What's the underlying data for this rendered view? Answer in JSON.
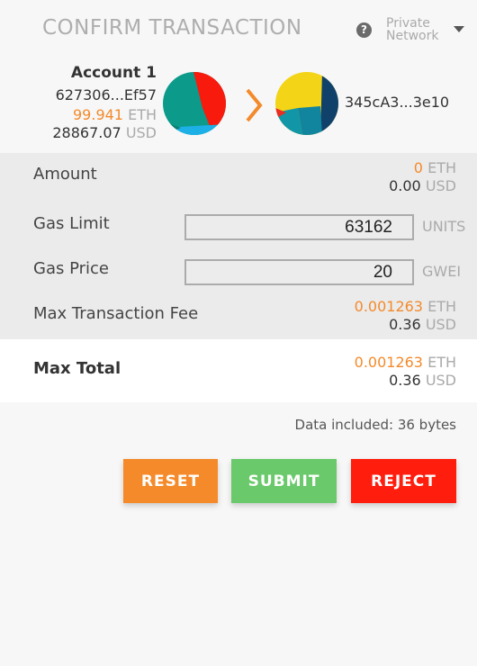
{
  "header": {
    "title": "CONFIRM TRANSACTION",
    "help_icon": "question-circle-icon",
    "network_line1": "Private",
    "network_line2": "Network",
    "network_caret_icon": "caret-down-icon"
  },
  "from": {
    "name": "Account 1",
    "address": "627306...Ef57",
    "eth_value": "99.941",
    "eth_unit": "ETH",
    "usd_value": "28867.07",
    "usd_unit": "USD",
    "identicon": "identicon-icon"
  },
  "arrow_icon": "chevron-right-icon",
  "to": {
    "address": "345cA3...3e10",
    "identicon": "identicon-icon"
  },
  "amount": {
    "label": "Amount",
    "eth_value": "0",
    "eth_unit": "ETH",
    "usd_value": "0.00",
    "usd_unit": "USD"
  },
  "gas_limit": {
    "label": "Gas Limit",
    "value": "63162",
    "unit": "UNITS"
  },
  "gas_price": {
    "label": "Gas Price",
    "value": "20",
    "unit": "GWEI"
  },
  "max_fee": {
    "label": "Max Transaction Fee",
    "eth_value": "0.001263",
    "eth_unit": "ETH",
    "usd_value": "0.36",
    "usd_unit": "USD"
  },
  "max_total": {
    "label": "Max Total",
    "eth_value": "0.001263",
    "eth_unit": "ETH",
    "usd_value": "0.36",
    "usd_unit": "USD"
  },
  "data_included": "Data included: 36 bytes",
  "buttons": {
    "reset": "RESET",
    "submit": "SUBMIT",
    "reject": "REJECT"
  },
  "colors": {
    "accent": "#f38a2b",
    "reset": "#f48a29",
    "submit": "#6ac96a",
    "reject": "#ff1d0d"
  }
}
